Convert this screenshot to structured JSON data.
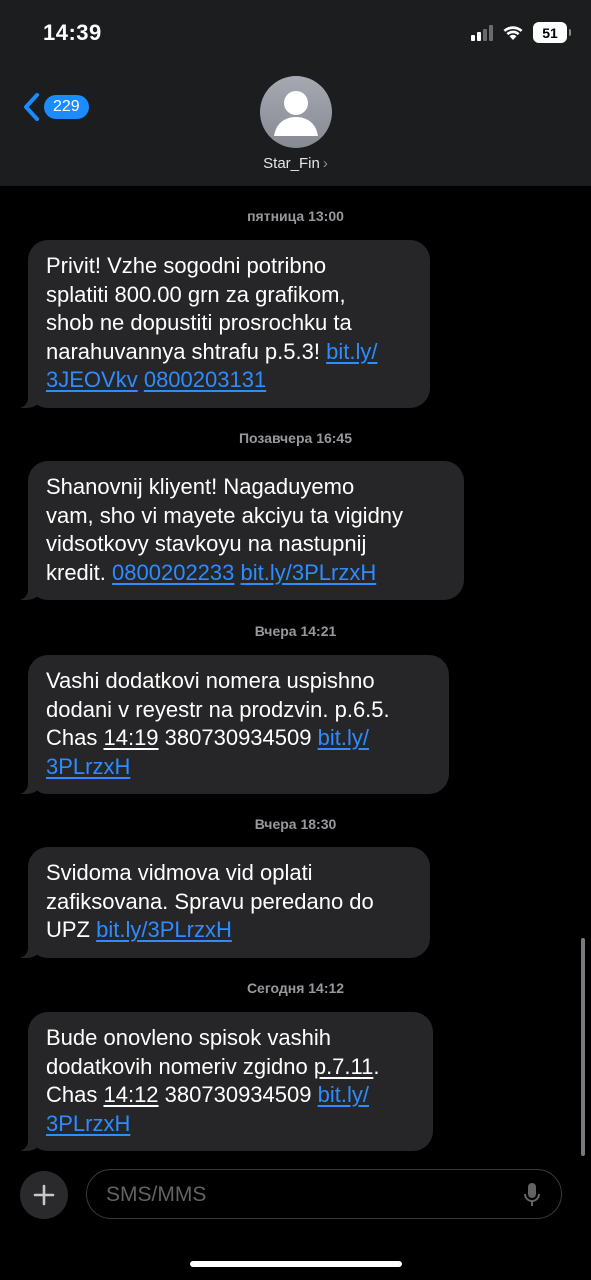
{
  "status_bar": {
    "time": "14:39",
    "battery": "51",
    "icons": [
      "signal-icon",
      "wifi-icon",
      "battery-icon"
    ]
  },
  "header": {
    "back_count": "229",
    "contact_name": "Star_Fin",
    "chevron": "›"
  },
  "messages": [
    {
      "timestamp": "пятница 13:00",
      "lines": [
        [
          {
            "t": "Privit! Vzhe sogodni potribno"
          }
        ],
        [
          {
            "t": "splatiti 800.00 grn za grafikom,"
          }
        ],
        [
          {
            "t": "shob ne dopustiti prosrochku ta"
          }
        ],
        [
          {
            "t": "narahuvannya shtrafu p.5.3! "
          },
          {
            "t": "bit.ly/",
            "link": true
          }
        ],
        [
          {
            "t": "3JEOVkv",
            "link": true
          },
          {
            "t": " "
          },
          {
            "t": "0800203131",
            "link": true
          }
        ]
      ]
    },
    {
      "timestamp": "Позавчера 16:45",
      "lines": [
        [
          {
            "t": "Shanovnij kliyent! Nagaduyemo"
          }
        ],
        [
          {
            "t": "vam, sho vi mayete akciyu ta vigidny"
          }
        ],
        [
          {
            "t": "vidsotkovy stavkoyu na nastupnij"
          }
        ],
        [
          {
            "t": "kredit. "
          },
          {
            "t": "0800202233",
            "link": true
          },
          {
            "t": " "
          },
          {
            "t": "bit.ly/3PLrzxH",
            "link": true
          }
        ]
      ]
    },
    {
      "timestamp": "Вчера 14:21",
      "lines": [
        [
          {
            "t": "Vashi dodatkovi nomera uspishno"
          }
        ],
        [
          {
            "t": "dodani v reyestr na prodzvin. p.6.5."
          }
        ],
        [
          {
            "t": "Chas "
          },
          {
            "t": "14:19",
            "ul": true
          },
          {
            "t": " 380730934509 "
          },
          {
            "t": "bit.ly/",
            "link": true
          }
        ],
        [
          {
            "t": "3PLrzxH",
            "link": true
          }
        ]
      ]
    },
    {
      "timestamp": "Вчера 18:30",
      "lines": [
        [
          {
            "t": "Svidoma vidmova vid oplati"
          }
        ],
        [
          {
            "t": "zafiksovana. Spravu peredano do"
          }
        ],
        [
          {
            "t": "UPZ "
          },
          {
            "t": "bit.ly/3PLrzxH",
            "link": true
          }
        ]
      ]
    },
    {
      "timestamp": "Сегодня 14:12",
      "lines": [
        [
          {
            "t": "Bude onovleno spisok vashih"
          }
        ],
        [
          {
            "t": "dodatkovih nomeriv zgidno "
          },
          {
            "t": "p.7.11",
            "ul": true
          },
          {
            "t": "."
          }
        ],
        [
          {
            "t": "Chas "
          },
          {
            "t": "14:12",
            "ul": true
          },
          {
            "t": " 380730934509 "
          },
          {
            "t": "bit.ly/",
            "link": true
          }
        ],
        [
          {
            "t": "3PLrzxH",
            "link": true
          }
        ]
      ]
    }
  ],
  "composer": {
    "placeholder": "SMS/MMS"
  },
  "colors": {
    "link": "#2d8cff",
    "bubble": "#262628",
    "header_bg": "#1c1d1f",
    "badge": "#1a8cff"
  }
}
